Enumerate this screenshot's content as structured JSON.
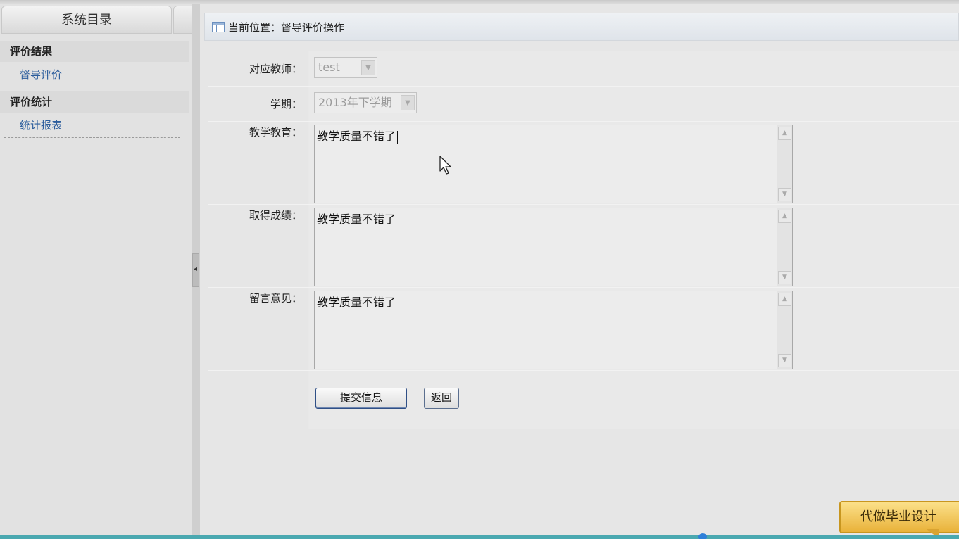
{
  "sidebar": {
    "title": "系统目录",
    "groups": [
      {
        "title": "评价结果",
        "items": [
          "督导评价"
        ]
      },
      {
        "title": "评价统计",
        "items": [
          "统计报表"
        ]
      }
    ]
  },
  "breadcrumb": {
    "text": "当前位置：督导评价操作"
  },
  "form": {
    "teacher": {
      "label": "对应教师：",
      "value": "test"
    },
    "term": {
      "label": "学期：",
      "value": "2013年下学期"
    },
    "teaching": {
      "label": "教学教育：",
      "value": "教学质量不错了"
    },
    "achievement": {
      "label": "取得成绩：",
      "value": "教学质量不错了"
    },
    "comment": {
      "label": "留言意见：",
      "value": "教学质量不错了"
    },
    "submit_label": "提交信息",
    "back_label": "返回"
  },
  "promo": {
    "text": "代做毕业设计"
  },
  "icons": {
    "breadcrumb": "page-icon",
    "select_arrow": "chevron-down-icon",
    "scroll_up": "chevron-up-icon",
    "scroll_down": "chevron-down-icon",
    "collapse": "caret-left-icon",
    "cursor": "mouse-pointer-icon"
  }
}
